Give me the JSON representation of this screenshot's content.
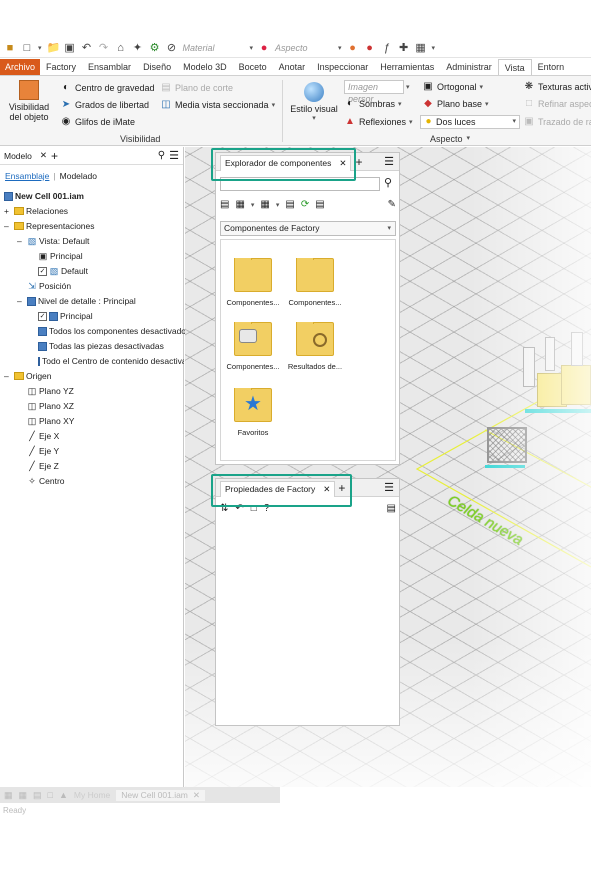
{
  "app": {
    "material_placeholder": "Material",
    "appearance_placeholder": "Aspecto"
  },
  "tabs": [
    "Archivo",
    "Factory",
    "Ensamblar",
    "Diseño",
    "Modelo 3D",
    "Boceto",
    "Anotar",
    "Inspeccionar",
    "Herramientas",
    "Administrar",
    "Vista",
    "Entorn"
  ],
  "active_tab": "Vista",
  "ribbon": {
    "visibility": {
      "object_visibility": "Visibilidad\ndel objeto",
      "center_of_gravity": "Centro de gravedad",
      "section_plane": "Plano de corte",
      "degrees_of_freedom": "Grados de libertad",
      "half_section_view": "Media vista seccionada",
      "imate_glyphs": "Glifos de iMate",
      "panel_title": "Visibilidad"
    },
    "appearance": {
      "visual_style": "Estilo visual",
      "image_style": "Imagen persor",
      "orthographic": "Ortogonal",
      "shadows": "Sombras",
      "ground_plane": "Plano base",
      "reflections": "Reflexiones",
      "lighting": "Dos luces",
      "active_textures": "Texturas activ",
      "refine_appearance": "Refinar aspec",
      "ray_tracing": "Trazado de ra",
      "panel_title": "Aspecto"
    }
  },
  "browser": {
    "tab_label": "Modelo",
    "subtab_assembly": "Ensamblaje",
    "subtab_modeling": "Modelado",
    "tree": [
      {
        "label": "New Cell 001.iam",
        "bold": true
      },
      {
        "label": "Relaciones"
      },
      {
        "label": "Representaciones"
      },
      {
        "label": "Vista: Default"
      },
      {
        "label": "Principal"
      },
      {
        "label": "Default"
      },
      {
        "label": "Posición"
      },
      {
        "label": "Nivel de detalle : Principal"
      },
      {
        "label": "Principal"
      },
      {
        "label": "Todos los componentes desactivados"
      },
      {
        "label": "Todas las piezas desactivadas"
      },
      {
        "label": "Todo el Centro de contenido desactivado"
      },
      {
        "label": "Origen"
      },
      {
        "label": "Plano YZ"
      },
      {
        "label": "Plano XZ"
      },
      {
        "label": "Plano XY"
      },
      {
        "label": "Eje X"
      },
      {
        "label": "Eje Y"
      },
      {
        "label": "Eje Z"
      },
      {
        "label": "Centro"
      }
    ]
  },
  "component_browser": {
    "tab_label": "Explorador de componentes",
    "dropdown_value": "Componentes de Factory",
    "items": [
      {
        "label": "Componentes..."
      },
      {
        "label": "Componentes..."
      },
      {
        "label": "Componentes..."
      },
      {
        "label": "Resultados de..."
      },
      {
        "label": "Favoritos"
      }
    ]
  },
  "properties_panel": {
    "tab_label": "Propiedades de Factory"
  },
  "viewport": {
    "scene_label": "Celda nueva"
  },
  "bottom": {
    "home_tab": "My Home",
    "doc_tab": "New Cell 001.iam",
    "status": "Ready"
  },
  "colors": {
    "file_tab": "#d95a1b",
    "highlight": "#1aa389",
    "scene_text": "#7ed321"
  }
}
